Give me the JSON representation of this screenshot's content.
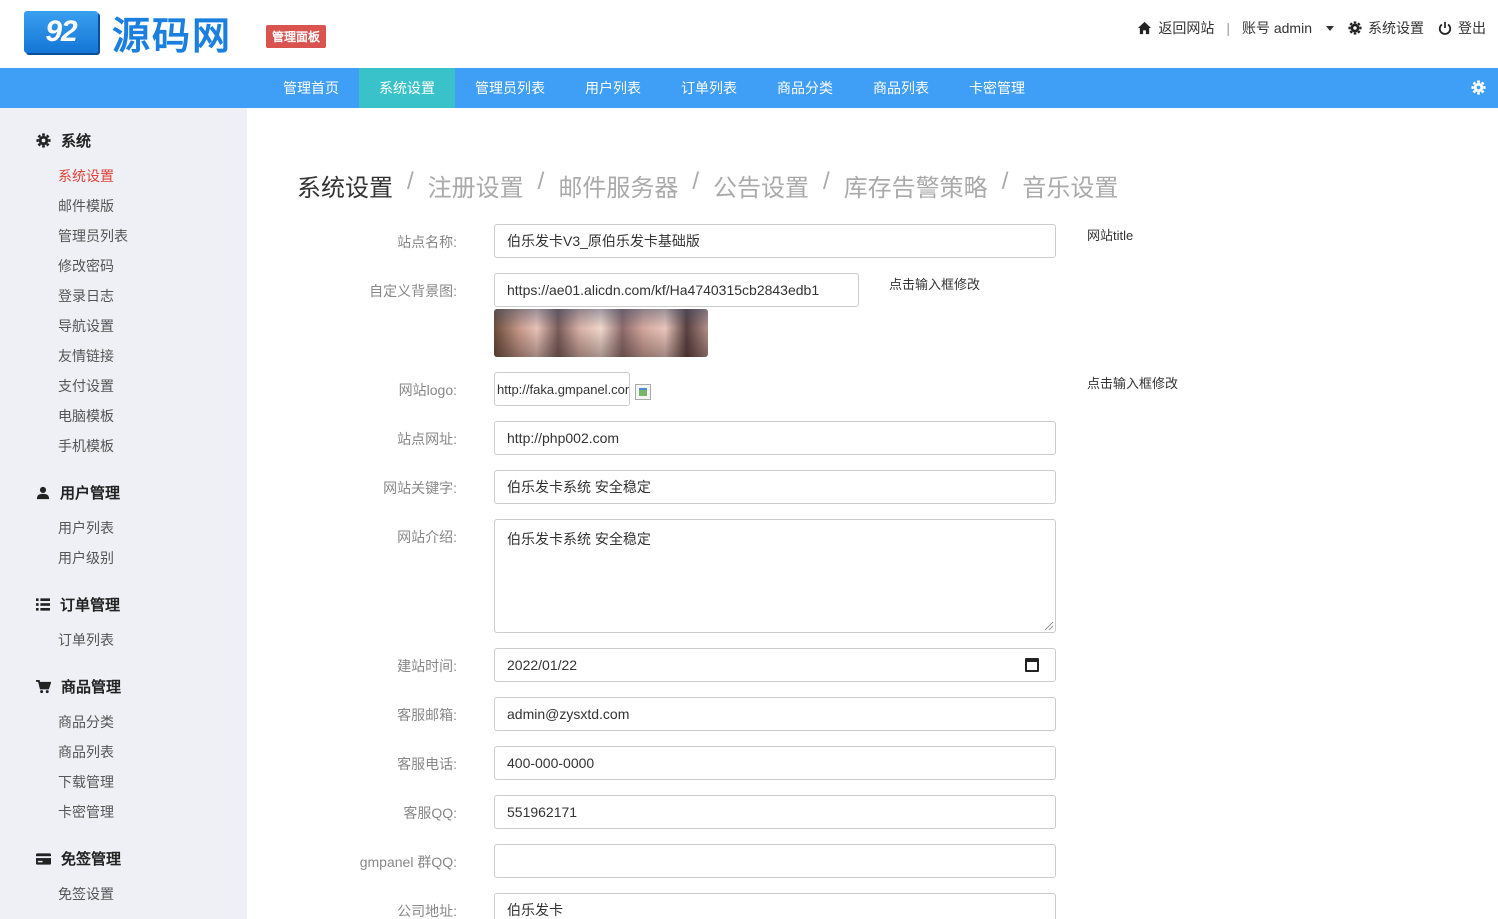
{
  "header": {
    "logo_mark": "92",
    "logo_text": "源码网",
    "badge": "管理面板",
    "links": {
      "back_site": "返回网站",
      "account": "账号 admin",
      "settings": "系统设置",
      "logout": "登出"
    }
  },
  "nav": {
    "tabs": [
      "管理首页",
      "系统设置",
      "管理员列表",
      "用户列表",
      "订单列表",
      "商品分类",
      "商品列表",
      "卡密管理"
    ],
    "active_index": 1
  },
  "sidebar": {
    "groups": [
      {
        "title": "系统",
        "icon": "gear-icon",
        "items": [
          "系统设置",
          "邮件模版",
          "管理员列表",
          "修改密码",
          "登录日志",
          "导航设置",
          "友情链接",
          "支付设置",
          "电脑模板",
          "手机模板"
        ]
      },
      {
        "title": "用户管理",
        "icon": "user-icon",
        "items": [
          "用户列表",
          "用户级别"
        ]
      },
      {
        "title": "订单管理",
        "icon": "list-icon",
        "items": [
          "订单列表"
        ]
      },
      {
        "title": "商品管理",
        "icon": "cart-icon",
        "items": [
          "商品分类",
          "商品列表",
          "下载管理",
          "卡密管理"
        ]
      },
      {
        "title": "免签管理",
        "icon": "card-icon",
        "items": [
          "免签设置"
        ]
      }
    ],
    "active_item": "系统设置"
  },
  "breadcrumbs": [
    "系统设置",
    "注册设置",
    "邮件服务器",
    "公告设置",
    "库存告警策略",
    "音乐设置"
  ],
  "form": {
    "site_name": {
      "label": "站点名称:",
      "value": "伯乐发卡V3_原伯乐发卡基础版",
      "hint": "网站title"
    },
    "background": {
      "label": "自定义背景图:",
      "value": "https://ae01.alicdn.com/kf/Ha4740315cb2843edb1",
      "hint": "点击输入框修改"
    },
    "logo": {
      "label": "网站logo:",
      "value": "http://faka.gmpanel.com",
      "hint": "点击输入框修改"
    },
    "site_url": {
      "label": "站点网址:",
      "value": "http://php002.com"
    },
    "keywords": {
      "label": "网站关键字:",
      "value": "伯乐发卡系统 安全稳定"
    },
    "intro": {
      "label": "网站介绍:",
      "value": "伯乐发卡系统 安全稳定"
    },
    "build_date": {
      "label": "建站时间:",
      "value": "2022/01/22"
    },
    "email": {
      "label": "客服邮箱:",
      "value": "admin@zysxtd.com"
    },
    "phone": {
      "label": "客服电话:",
      "value": "400-000-0000"
    },
    "qq": {
      "label": "客服QQ:",
      "value": "551962171"
    },
    "group_qq": {
      "label": "gmpanel 群QQ:",
      "value": ""
    },
    "address": {
      "label": "公司地址:",
      "value": "伯乐发卡"
    }
  },
  "colors": {
    "nav_bg": "#3f9ef5",
    "nav_active": "#39c2c9",
    "sidebar_bg": "#eef0f5",
    "active_link": "#e0433a",
    "badge": "#d9534f"
  }
}
